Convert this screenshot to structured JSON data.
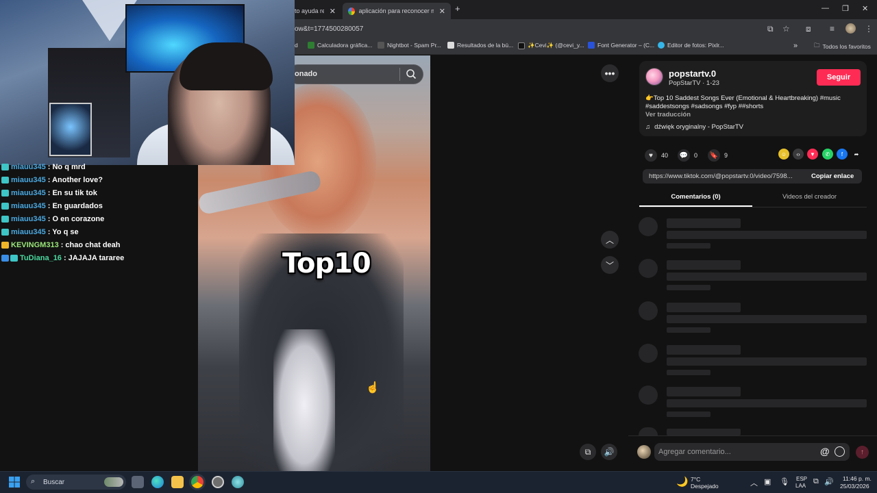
{
  "browser": {
    "tabs": [
      {
        "label": "to ayuda res",
        "active": false
      },
      {
        "label": "aplicación para reconocer músi",
        "active": true
      }
    ],
    "url": "ow&t=1774500280057",
    "bookmarks": [
      "d",
      "Calculadora gráfica...",
      "Nightbot - Spam Pr...",
      "Resultados de la bú...",
      "✨Cevi✨ (@cevi_y...",
      "Font Generator – (C...",
      "Editor de fotos: Pixlr..."
    ],
    "all_bookmarks": "Todos los favoritos"
  },
  "search": {
    "text": "onado"
  },
  "video": {
    "overlay_text": "Top10"
  },
  "post": {
    "username": "popstartv.0",
    "handle": "PopStarTV · 1-23",
    "follow_label": "Seguir",
    "description_line1": "👉Top 10 Saddest Songs Ever (Emotional & Heartbreaking) #music",
    "description_line2": "#saddestsongs #sadsongs #fyp ##shorts",
    "translate_label": "Ver traducción",
    "music": "dźwięk oryginalny - PopStarTV",
    "likes": "40",
    "comments": "0",
    "saves": "9",
    "link": "https://www.tiktok.com/@popstartv.0/video/7598...",
    "copy_label": "Copiar enlace"
  },
  "tabs": {
    "comments": "Comentarios (0)",
    "creator": "Videos del creador"
  },
  "comment_box": {
    "placeholder": "Agregar comentario..."
  },
  "chat": [
    {
      "user": "miauu345",
      "msg": ": No q mrd",
      "color": "#4aa8e0",
      "badge": "#3ec5c5"
    },
    {
      "user": "miauu345",
      "msg": ": Another love?",
      "color": "#4aa8e0",
      "badge": "#3ec5c5"
    },
    {
      "user": "miauu345",
      "msg": ": En su tik tok",
      "color": "#4aa8e0",
      "badge": "#3ec5c5"
    },
    {
      "user": "miauu345",
      "msg": ": En guardados",
      "color": "#4aa8e0",
      "badge": "#3ec5c5"
    },
    {
      "user": "miauu345",
      "msg": ": O en corazone",
      "color": "#4aa8e0",
      "badge": "#3ec5c5"
    },
    {
      "user": "miauu345",
      "msg": ": Yo q se",
      "color": "#4aa8e0",
      "badge": "#3ec5c5"
    },
    {
      "user": "KEVINGM313",
      "msg": ": chao chat deah",
      "color": "#9be77a",
      "badge": "#f0b429"
    },
    {
      "user": "TuDiana_16",
      "msg": ": JAJAJA tararee",
      "color": "#4ad9a0",
      "badge": "#3a8ee6"
    }
  ],
  "taskbar": {
    "search": "Buscar",
    "weather_temp": "7°C",
    "weather_desc": "Despejado",
    "lang1": "ESP",
    "lang2": "LAA",
    "time": "11:46 p. m.",
    "date": "25/03/2026"
  },
  "colors": {
    "accent": "#fe2c55",
    "page_bg": "#121212",
    "card_bg": "#1e1e1e"
  }
}
